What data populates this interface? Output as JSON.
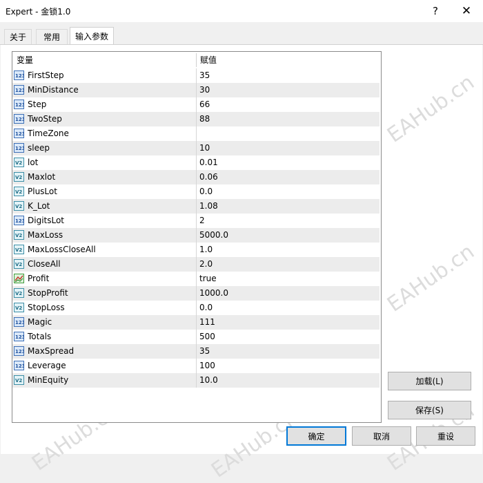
{
  "window": {
    "title": "Expert - 金锁1.0",
    "help_glyph": "?",
    "close_glyph": "✕"
  },
  "tabs": [
    {
      "label": "关于",
      "active": false
    },
    {
      "label": "常用",
      "active": false
    },
    {
      "label": "输入参数",
      "active": true
    }
  ],
  "grid": {
    "col_variable": "变量",
    "col_value": "赋值",
    "rows": [
      {
        "name": "FirstStep",
        "value": "35",
        "icon": "int-icon"
      },
      {
        "name": "MinDistance",
        "value": "30",
        "icon": "int-icon"
      },
      {
        "name": "Step",
        "value": "66",
        "icon": "int-icon"
      },
      {
        "name": "TwoStep",
        "value": "88",
        "icon": "int-icon"
      },
      {
        "name": "TimeZone",
        "value": "",
        "icon": "int-icon"
      },
      {
        "name": "sleep",
        "value": "10",
        "icon": "int-icon"
      },
      {
        "name": "lot",
        "value": "0.01",
        "icon": "double-icon"
      },
      {
        "name": "Maxlot",
        "value": "0.06",
        "icon": "double-icon"
      },
      {
        "name": "PlusLot",
        "value": "0.0",
        "icon": "double-icon"
      },
      {
        "name": "K_Lot",
        "value": "1.08",
        "icon": "double-icon"
      },
      {
        "name": "DigitsLot",
        "value": "2",
        "icon": "int-icon"
      },
      {
        "name": "MaxLoss",
        "value": "5000.0",
        "icon": "double-icon"
      },
      {
        "name": "MaxLossCloseAll",
        "value": "1.0",
        "icon": "double-icon"
      },
      {
        "name": "CloseAll",
        "value": "2.0",
        "icon": "double-icon"
      },
      {
        "name": "Profit",
        "value": "true",
        "icon": "bool-icon"
      },
      {
        "name": "StopProfit",
        "value": "1000.0",
        "icon": "double-icon"
      },
      {
        "name": "StopLoss",
        "value": "0.0",
        "icon": "double-icon"
      },
      {
        "name": "Magic",
        "value": "111",
        "icon": "int-icon"
      },
      {
        "name": "Totals",
        "value": "500",
        "icon": "int-icon"
      },
      {
        "name": "MaxSpread",
        "value": "35",
        "icon": "int-icon"
      },
      {
        "name": "Leverage",
        "value": "100",
        "icon": "int-icon"
      },
      {
        "name": "MinEquity",
        "value": "10.0",
        "icon": "double-icon"
      }
    ]
  },
  "buttons": {
    "load": "加载(L)",
    "save": "保存(S)",
    "ok": "确定",
    "cancel": "取消",
    "reset": "重设"
  },
  "watermark": "EAHub.cn"
}
